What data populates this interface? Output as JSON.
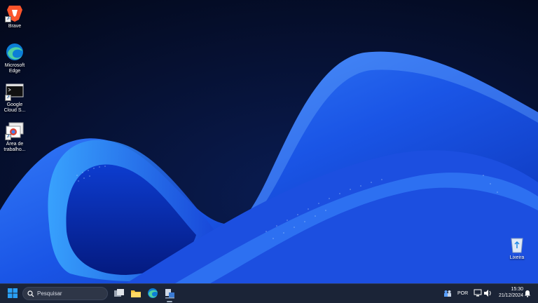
{
  "desktop": {
    "icons": [
      {
        "label": "Brave"
      },
      {
        "label": "Microsoft Edge"
      },
      {
        "label": "Google Cloud S..."
      },
      {
        "label": "Área de trabalho..."
      },
      {
        "label": "Lixeira"
      }
    ]
  },
  "taskbar": {
    "search_placeholder": "Pesquisar",
    "language": "POR",
    "time": "15:30",
    "date": "21/12/2024"
  },
  "colors": {
    "wallpaper_bg": "#050b1f",
    "wave": "#1d55e8",
    "taskbar": "#1b2437",
    "accent": "#0078d4"
  }
}
